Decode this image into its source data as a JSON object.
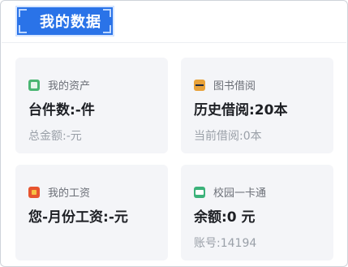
{
  "header": {
    "title": "我的数据"
  },
  "cards": [
    {
      "label": "我的资产",
      "icon": "asset-icon",
      "main": "台件数:-件",
      "sub": "总金额:-元"
    },
    {
      "label": "图书借阅",
      "icon": "book-icon",
      "main": "历史借阅:20本",
      "sub": "当前借阅:0本"
    },
    {
      "label": "我的工资",
      "icon": "salary-icon",
      "main": "您-月份工资:-元",
      "sub": ""
    },
    {
      "label": "校园一卡通",
      "icon": "campus-card-icon",
      "main": "余额:0 元",
      "sub": "账号:14194"
    }
  ]
}
